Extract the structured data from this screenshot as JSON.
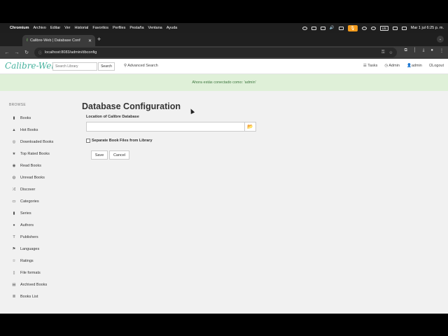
{
  "menubar": {
    "items": [
      "Chromium",
      "Archivo",
      "Editar",
      "Ver",
      "Historial",
      "Favoritos",
      "Perfiles",
      "Pestaña",
      "Ventana",
      "Ayuda"
    ],
    "input_source": "US",
    "clock": "Mar 1 jul  6:25 p. m."
  },
  "browser": {
    "tab_title": "Calibre-Web | Database Conf",
    "url": "localhost:8083/admin/dbconfig"
  },
  "navbar": {
    "brand": "Calibre-Web",
    "search_placeholder": "Search Library",
    "search_button": "Search",
    "advanced_search": "Advanced Search",
    "tasks": "Tasks",
    "admin": "Admin",
    "user": "admin",
    "logout": "Logout"
  },
  "flash": {
    "message": "Ahora estás conectado como: 'admin'"
  },
  "sidebar": {
    "heading": "BROWSE",
    "items": [
      {
        "label": "Books",
        "icon": "book-icon"
      },
      {
        "label": "Hot Books",
        "icon": "fire-icon"
      },
      {
        "label": "Downloaded Books",
        "icon": "download-icon"
      },
      {
        "label": "Top Rated Books",
        "icon": "star-icon"
      },
      {
        "label": "Read Books",
        "icon": "eye-icon"
      },
      {
        "label": "Unread Books",
        "icon": "eye-slash-icon"
      },
      {
        "label": "Discover",
        "icon": "shuffle-icon"
      },
      {
        "label": "Categories",
        "icon": "inbox-icon"
      },
      {
        "label": "Series",
        "icon": "bookmark-icon"
      },
      {
        "label": "Authors",
        "icon": "user-icon"
      },
      {
        "label": "Publishers",
        "icon": "text-size-icon"
      },
      {
        "label": "Languages",
        "icon": "flag-icon"
      },
      {
        "label": "Ratings",
        "icon": "star-empty-icon"
      },
      {
        "label": "File formats",
        "icon": "file-icon"
      },
      {
        "label": "Archived Books",
        "icon": "archive-icon"
      },
      {
        "label": "Books List",
        "icon": "list-icon"
      }
    ]
  },
  "main": {
    "title": "Database Configuration",
    "db_location_label": "Location of Calibre Database",
    "db_location_value": "",
    "split_library_label": "Separate Book Files from Library",
    "save_label": "Save",
    "cancel_label": "Cancel"
  },
  "colors": {
    "brand": "#45b29d",
    "flash_bg": "#dff0d8",
    "flash_text": "#3c763d",
    "page_bg": "#f1f1f1"
  }
}
